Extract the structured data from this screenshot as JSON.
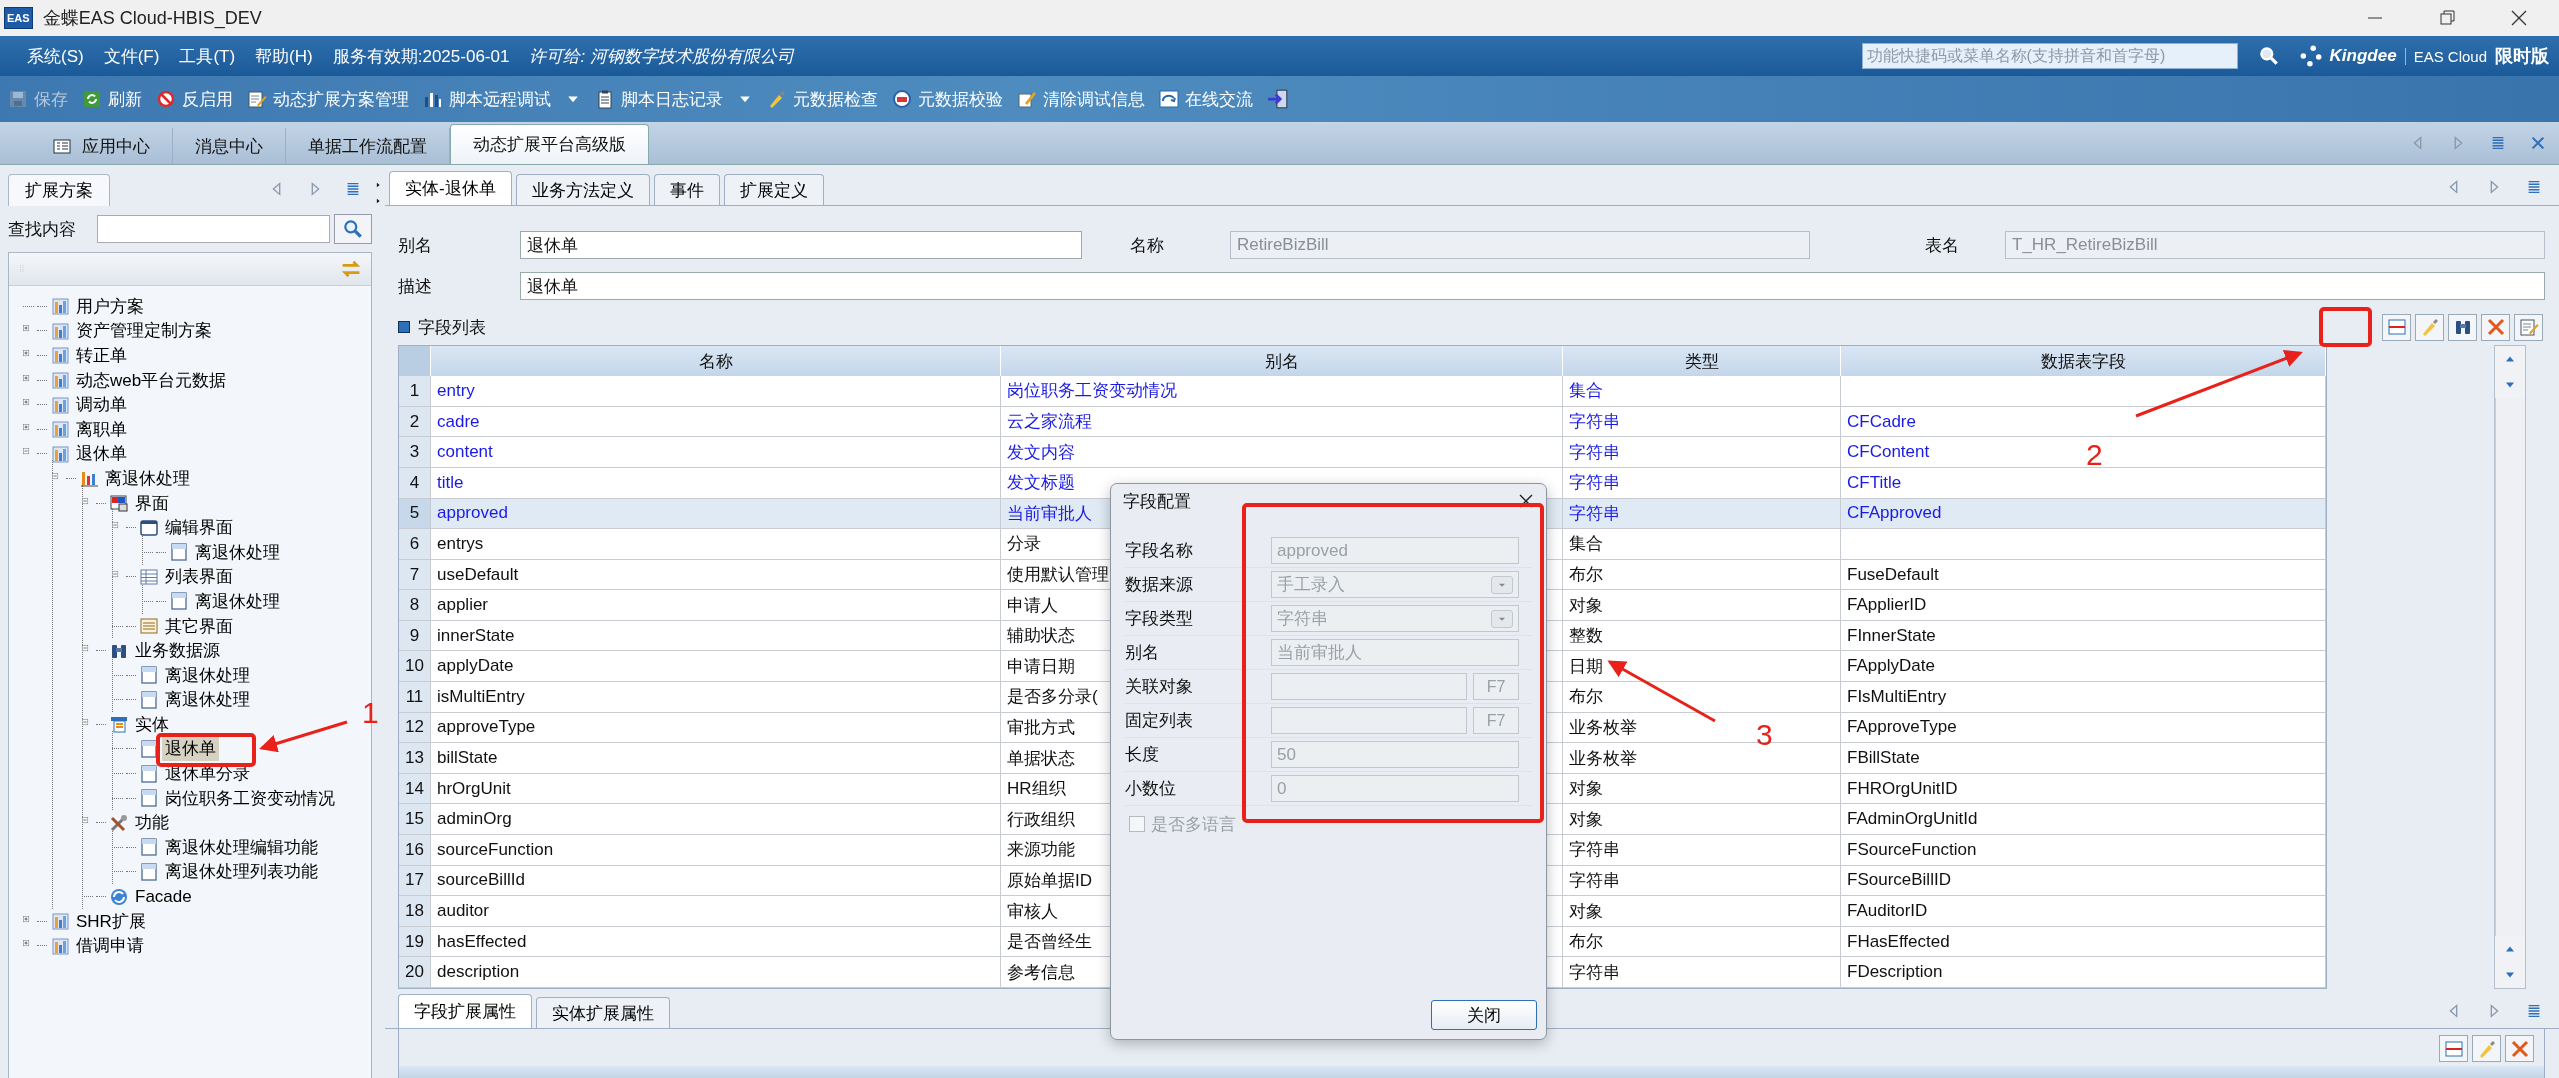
{
  "window": {
    "icon_label": "EAS",
    "title": "金蝶EAS Cloud-HBIS_DEV"
  },
  "menu": {
    "items": [
      "系统(S)",
      "文件(F)",
      "工具(T)",
      "帮助(H)"
    ],
    "service": "服务有效期:2025-06-01",
    "license": "许可给: 河钢数字技术股份有限公司",
    "search_placeholder": "功能快捷码或菜单名称(支持拼音和首字母)",
    "brand": "Kingdee",
    "product": "EAS Cloud",
    "edition": "限时版"
  },
  "toolbar": [
    {
      "kind": "save",
      "label": "保存",
      "disabled": true
    },
    {
      "kind": "refresh",
      "label": "刷新",
      "disabled": false
    },
    {
      "kind": "disable",
      "label": "反启用",
      "disabled": false
    },
    {
      "kind": "manage",
      "label": "动态扩展方案管理",
      "disabled": false
    },
    {
      "kind": "remote-debug",
      "label": "脚本远程调试",
      "disabled": false,
      "dropdown": true
    },
    {
      "kind": "log",
      "label": "脚本日志记录",
      "disabled": false,
      "dropdown": true
    },
    {
      "kind": "check",
      "label": "元数据检查",
      "disabled": false
    },
    {
      "kind": "verify",
      "label": "元数据校验",
      "disabled": false
    },
    {
      "kind": "clear",
      "label": "清除调试信息",
      "disabled": false
    },
    {
      "kind": "chat",
      "label": "在线交流",
      "disabled": false
    },
    {
      "kind": "exit",
      "disabled": false
    }
  ],
  "tabs": [
    {
      "label": "应用中心",
      "selected": false,
      "icon": true
    },
    {
      "label": "消息中心",
      "selected": false
    },
    {
      "label": "单据工作流配置",
      "selected": false
    },
    {
      "label": "动态扩展平台高级版",
      "selected": true
    }
  ],
  "left_panel": {
    "tab": "扩展方案",
    "search_label": "查找内容",
    "tree": [
      {
        "label": "用户方案",
        "kind": "package",
        "selected": false
      },
      {
        "label": "资产管理定制方案",
        "kind": "package",
        "expanded": false,
        "selected": false
      },
      {
        "label": "转正单",
        "kind": "package",
        "expanded": false,
        "selected": false
      },
      {
        "label": "动态web平台元数据",
        "kind": "package",
        "expanded": false,
        "selected": false
      },
      {
        "label": "调动单",
        "kind": "package",
        "expanded": false,
        "selected": false
      },
      {
        "label": "离职单",
        "kind": "package",
        "expanded": false,
        "selected": false
      },
      {
        "label": "退休单",
        "kind": "package",
        "expanded": true,
        "selected": false,
        "children": [
          {
            "label": "离退休处理",
            "kind": "module",
            "expanded": true,
            "selected": false,
            "children": [
              {
                "label": "界面",
                "kind": "ui",
                "expanded": true,
                "selected": false,
                "children": [
                  {
                    "label": "编辑界面",
                    "kind": "edit-ui",
                    "expanded": true,
                    "selected": false,
                    "children": [
                      {
                        "label": "离退休处理",
                        "kind": "doc",
                        "selected": false
                      }
                    ]
                  },
                  {
                    "label": "列表界面",
                    "kind": "list-ui",
                    "expanded": true,
                    "selected": false,
                    "children": [
                      {
                        "label": "离退休处理",
                        "kind": "doc",
                        "selected": false
                      }
                    ]
                  },
                  {
                    "label": "其它界面",
                    "kind": "other-ui",
                    "selected": false
                  }
                ]
              },
              {
                "label": "业务数据源",
                "kind": "datasource",
                "expanded": true,
                "selected": false,
                "children": [
                  {
                    "label": "离退休处理",
                    "kind": "doc",
                    "selected": false
                  },
                  {
                    "label": "离退休处理",
                    "kind": "doc",
                    "selected": false
                  }
                ]
              },
              {
                "label": "实体",
                "kind": "entity",
                "expanded": true,
                "selected": false,
                "children": [
                  {
                    "label": "退休单",
                    "kind": "doc",
                    "selected": true
                  },
                  {
                    "label": "退休单分录",
                    "kind": "doc",
                    "selected": false
                  },
                  {
                    "label": "岗位职务工资变动情况",
                    "kind": "doc",
                    "selected": false
                  }
                ]
              },
              {
                "label": "功能",
                "kind": "function",
                "expanded": true,
                "selected": false,
                "children": [
                  {
                    "label": "离退休处理编辑功能",
                    "kind": "doc",
                    "selected": false
                  },
                  {
                    "label": "离退休处理列表功能",
                    "kind": "doc",
                    "selected": false
                  }
                ]
              },
              {
                "label": "Facade",
                "kind": "facade",
                "selected": false
              }
            ]
          }
        ]
      },
      {
        "label": "SHR扩展",
        "kind": "package",
        "expanded": false,
        "selected": false
      },
      {
        "label": "借调申请",
        "kind": "package",
        "expanded": false,
        "selected": false
      }
    ]
  },
  "sub_tabs": [
    {
      "label": "实体-退休单",
      "selected": true
    },
    {
      "label": "业务方法定义",
      "selected": false
    },
    {
      "label": "事件",
      "selected": false
    },
    {
      "label": "扩展定义",
      "selected": false
    }
  ],
  "form": {
    "alias_label": "别名",
    "alias": "退休单",
    "name_label": "名称",
    "name": "RetireBizBill",
    "table_label": "表名",
    "table": "T_HR_RetireBizBill",
    "desc_label": "描述",
    "desc": "退休单"
  },
  "field_list": {
    "title": "字段列表",
    "columns": [
      "名称",
      "别名",
      "类型",
      "数据表字段"
    ],
    "rows": [
      {
        "no": "1",
        "name": "entry",
        "alias": "岗位职务工资变动情况",
        "type": "集合",
        "custom": true,
        "selected": false
      },
      {
        "no": "2",
        "name": "cadre",
        "alias": "云之家流程",
        "type": "字符串",
        "field": "CFCadre",
        "custom": true,
        "selected": false
      },
      {
        "no": "3",
        "name": "content",
        "alias": "发文内容",
        "type": "字符串",
        "field": "CFContent",
        "custom": true,
        "selected": false
      },
      {
        "no": "4",
        "name": "title",
        "alias": "发文标题",
        "type": "字符串",
        "field": "CFTitle",
        "custom": true,
        "selected": false
      },
      {
        "no": "5",
        "name": "approved",
        "alias": "当前审批人",
        "type": "字符串",
        "field": "CFApproved",
        "custom": true,
        "selected": true
      },
      {
        "no": "6",
        "name": "entrys",
        "alias": "分录",
        "type": "集合",
        "custom": false,
        "selected": false
      },
      {
        "no": "7",
        "name": "useDefault",
        "alias": "使用默认管理",
        "type": "布尔",
        "field": "FuseDefault",
        "custom": false,
        "selected": false
      },
      {
        "no": "8",
        "name": "applier",
        "alias": "申请人",
        "type": "对象",
        "field": "FApplierID",
        "custom": false,
        "selected": false
      },
      {
        "no": "9",
        "name": "innerState",
        "alias": "辅助状态",
        "type": "整数",
        "field": "FInnerState",
        "custom": false,
        "selected": false
      },
      {
        "no": "10",
        "name": "applyDate",
        "alias": "申请日期",
        "type": "日期",
        "field": "FApplyDate",
        "custom": false,
        "selected": false
      },
      {
        "no": "11",
        "name": "isMultiEntry",
        "alias": "是否多分录(",
        "type": "布尔",
        "field": "FIsMultiEntry",
        "custom": false,
        "selected": false
      },
      {
        "no": "12",
        "name": "approveType",
        "alias": "审批方式",
        "type": "业务枚举",
        "field": "FApproveType",
        "custom": false,
        "selected": false
      },
      {
        "no": "13",
        "name": "billState",
        "alias": "单据状态",
        "type": "业务枚举",
        "field": "FBillState",
        "custom": false,
        "selected": false
      },
      {
        "no": "14",
        "name": "hrOrgUnit",
        "alias": "HR组织",
        "type": "对象",
        "field": "FHROrgUnitID",
        "custom": false,
        "selected": false
      },
      {
        "no": "15",
        "name": "adminOrg",
        "alias": "行政组织",
        "type": "对象",
        "field": "FAdminOrgUnitId",
        "custom": false,
        "selected": false
      },
      {
        "no": "16",
        "name": "sourceFunction",
        "alias": "来源功能",
        "type": "字符串",
        "field": "FSourceFunction",
        "custom": false,
        "selected": false
      },
      {
        "no": "17",
        "name": "sourceBillId",
        "alias": "原始单据ID",
        "type": "字符串",
        "field": "FSourceBillID",
        "custom": false,
        "selected": false
      },
      {
        "no": "18",
        "name": "auditor",
        "alias": "审核人",
        "type": "对象",
        "field": "FAuditorID",
        "custom": false,
        "selected": false
      },
      {
        "no": "19",
        "name": "hasEffected",
        "alias": "是否曾经生",
        "type": "布尔",
        "field": "FHasEffected",
        "custom": false,
        "selected": false
      },
      {
        "no": "20",
        "name": "description",
        "alias": "参考信息",
        "type": "字符串",
        "field": "FDescription",
        "custom": false,
        "selected": false
      }
    ]
  },
  "bottom_tabs": [
    {
      "label": "字段扩展属性",
      "selected": true
    },
    {
      "label": "实体扩展属性",
      "selected": false
    }
  ],
  "dialog": {
    "title": "字段配置",
    "fields": [
      {
        "label": "字段名称",
        "kind": "text",
        "value": "approved"
      },
      {
        "label": "数据来源",
        "kind": "select",
        "value": "手工录入"
      },
      {
        "label": "字段类型",
        "kind": "select",
        "value": "字符串"
      },
      {
        "label": "别名",
        "kind": "text",
        "value": "当前审批人"
      },
      {
        "label": "关联对象",
        "kind": "f7",
        "button": "F7"
      },
      {
        "label": "固定列表",
        "kind": "f7",
        "button": "F7"
      },
      {
        "label": "长度",
        "kind": "text",
        "value": "50"
      },
      {
        "label": "小数位",
        "kind": "text",
        "value": "0"
      }
    ],
    "checkbox": {
      "label": "是否多语言",
      "checked": false
    },
    "close_button": "关闭"
  },
  "annotations": [
    {
      "number": "1"
    },
    {
      "number": "2"
    },
    {
      "number": "3"
    }
  ]
}
